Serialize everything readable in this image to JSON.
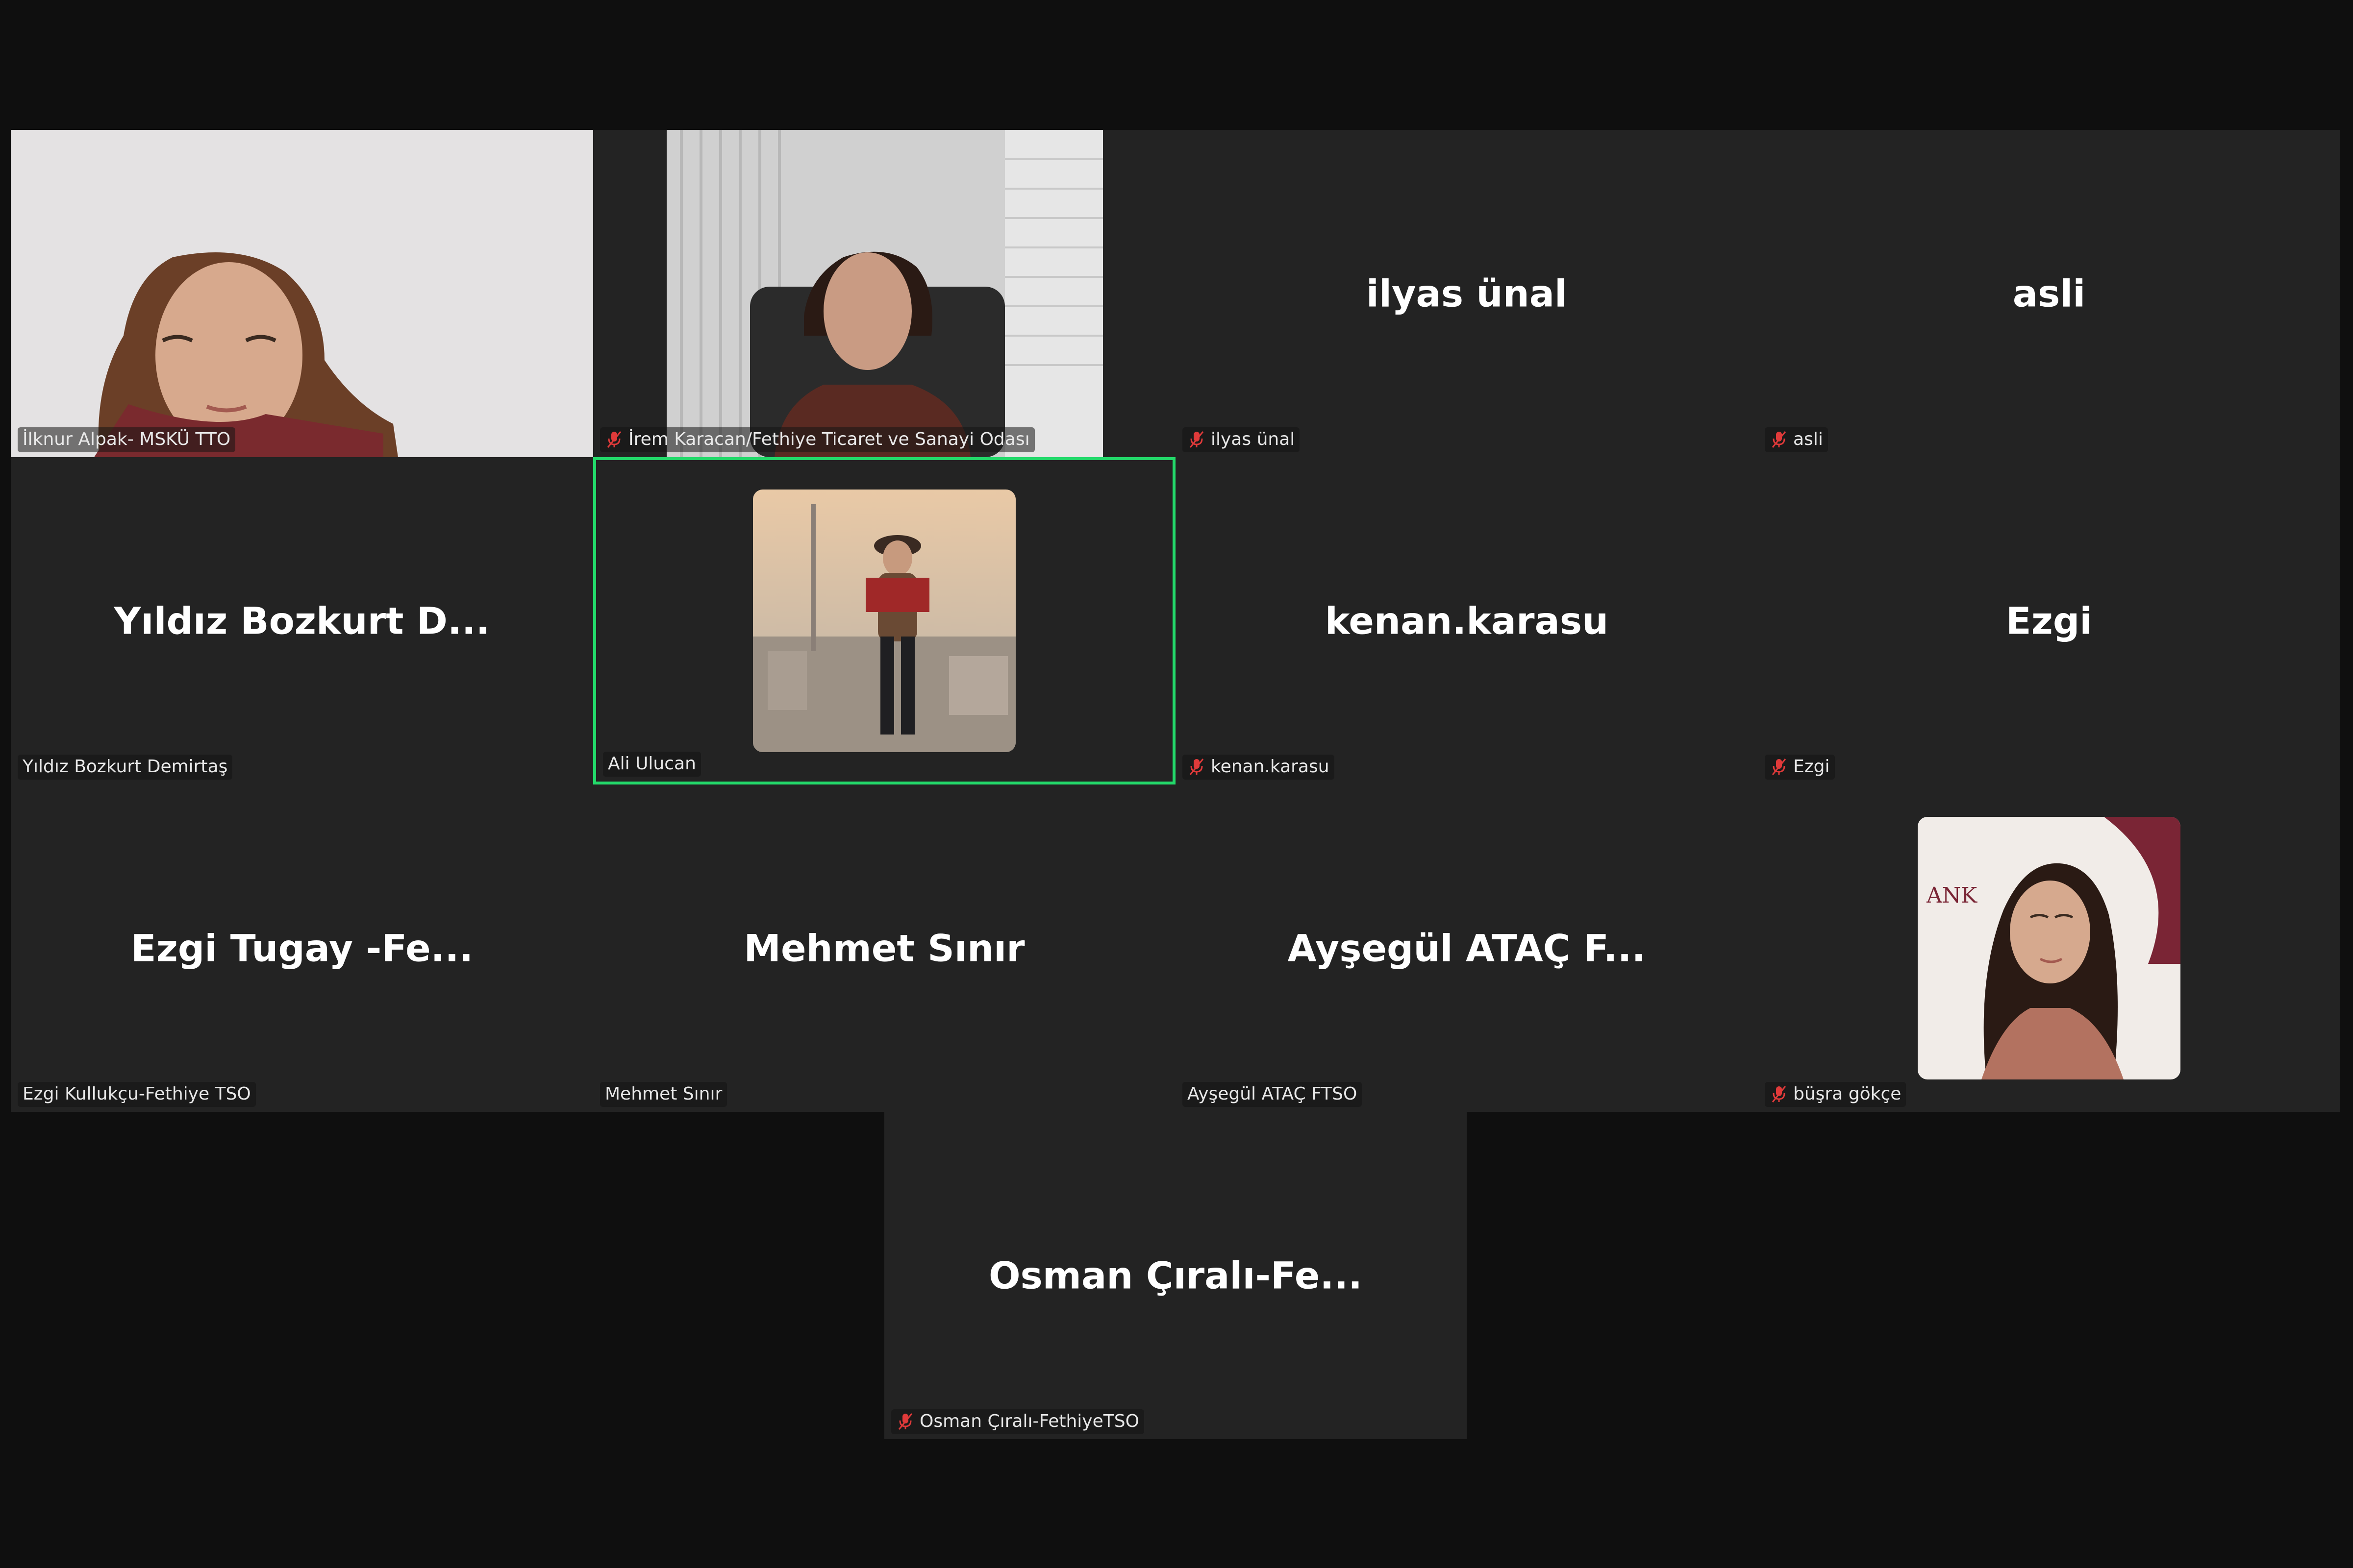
{
  "meeting": {
    "participants": [
      {
        "id": "p1",
        "tile_text": "",
        "label": "İlknur Alpak- MSKÜ TTO",
        "muted": false,
        "video": "on"
      },
      {
        "id": "p2",
        "tile_text": "",
        "label": "İrem Karacan/Fethiye Ticaret ve Sanayi Odası",
        "muted": true,
        "video": "on"
      },
      {
        "id": "p3",
        "tile_text": "ilyas ünal",
        "label": "ilyas ünal",
        "muted": true,
        "video": "off"
      },
      {
        "id": "p4",
        "tile_text": "asli",
        "label": "asli",
        "muted": true,
        "video": "off"
      },
      {
        "id": "p5",
        "tile_text": "Yıldız Bozkurt D...",
        "label": "Yıldız Bozkurt Demirtaş",
        "muted": false,
        "video": "off"
      },
      {
        "id": "p6",
        "tile_text": "",
        "label": "Ali Ulucan",
        "muted": false,
        "video": "avatar",
        "active_speaker": true
      },
      {
        "id": "p7",
        "tile_text": "kenan.karasu",
        "label": "kenan.karasu",
        "muted": true,
        "video": "off"
      },
      {
        "id": "p8",
        "tile_text": "Ezgi",
        "label": "Ezgi",
        "muted": true,
        "video": "off"
      },
      {
        "id": "p9",
        "tile_text": "Ezgi Tugay -Fe...",
        "label": "Ezgi Kullukçu-Fethiye TSO",
        "muted": false,
        "video": "off"
      },
      {
        "id": "p10",
        "tile_text": "Mehmet Sınır",
        "label": "Mehmet Sınır",
        "muted": false,
        "video": "off"
      },
      {
        "id": "p11",
        "tile_text": "Ayşegül ATAÇ F...",
        "label": "Ayşegül ATAÇ FTSO",
        "muted": false,
        "video": "off"
      },
      {
        "id": "p12",
        "tile_text": "",
        "label": "büşra gökçe",
        "muted": true,
        "video": "avatar"
      },
      {
        "id": "p13",
        "tile_text": "Osman Çıralı-Fe...",
        "label": "Osman Çıralı-FethiyeTSO",
        "muted": true,
        "video": "off"
      }
    ],
    "p12_background_text": "ANK",
    "colors": {
      "active_border": "#23d96a",
      "tile_bg": "#232323",
      "page_bg": "#0f0f0f",
      "mute_icon": "#e03a3a"
    }
  }
}
